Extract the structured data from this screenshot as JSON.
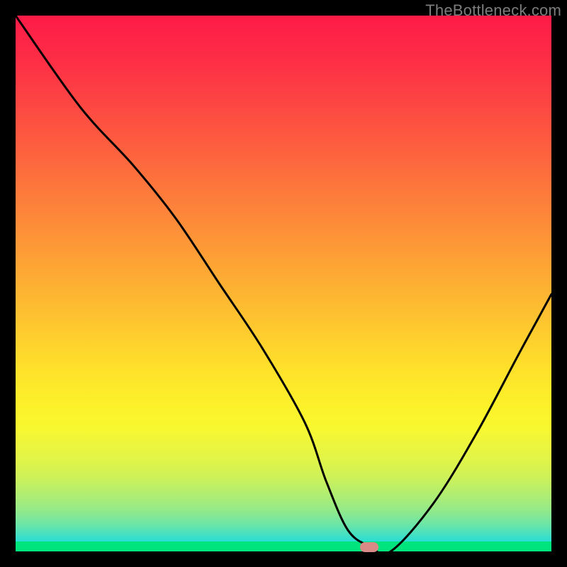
{
  "watermark": "TheBottleneck.com",
  "chart_data": {
    "type": "line",
    "title": "",
    "xlabel": "",
    "ylabel": "",
    "xlim": [
      0,
      100
    ],
    "ylim": [
      0,
      100
    ],
    "x": [
      0,
      12,
      22,
      30,
      38,
      46,
      54,
      58,
      62,
      66,
      70,
      78,
      86,
      94,
      100
    ],
    "values": [
      100,
      83,
      72,
      62,
      50,
      38,
      24,
      13,
      4,
      1,
      0,
      9,
      22,
      37,
      48
    ],
    "marker": {
      "x": 66,
      "y": 0.8
    },
    "gradient_stops": [
      {
        "pos": 0,
        "color": "#fd1b48"
      },
      {
        "pos": 50,
        "color": "#fdb532"
      },
      {
        "pos": 75,
        "color": "#f8f830"
      },
      {
        "pos": 100,
        "color": "#00d8ee"
      }
    ]
  }
}
